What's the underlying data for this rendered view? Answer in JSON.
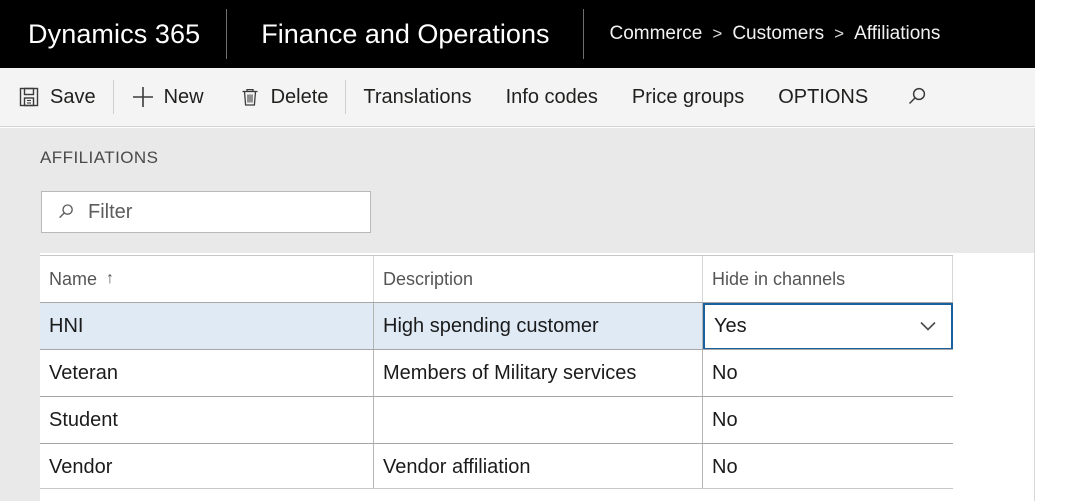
{
  "topbar": {
    "brand": "Dynamics 365",
    "module": "Finance and Operations",
    "breadcrumb": {
      "items": [
        "Commerce",
        "Customers",
        "Affiliations"
      ],
      "separator": ">"
    }
  },
  "command_bar": {
    "items": [
      {
        "label": "Save",
        "icon": "save-icon"
      },
      {
        "label": "New",
        "icon": "plus-icon"
      },
      {
        "label": "Delete",
        "icon": "trash-icon"
      },
      {
        "label": "Translations",
        "icon": ""
      },
      {
        "label": "Info codes",
        "icon": ""
      },
      {
        "label": "Price groups",
        "icon": ""
      },
      {
        "label": "OPTIONS",
        "icon": ""
      }
    ],
    "search_icon": "search-icon"
  },
  "page": {
    "section_title": "AFFILIATIONS",
    "filter": {
      "icon": "search-icon",
      "value": "",
      "placeholder": "Filter"
    },
    "grid": {
      "columns": [
        {
          "label": "Name",
          "sort": "↑"
        },
        {
          "label": "Description",
          "sort": ""
        },
        {
          "label": "Hide in channels",
          "sort": ""
        }
      ],
      "rows": [
        {
          "name": "HNI",
          "description": "High spending customer",
          "hide_in_channels": "Yes",
          "selected": true,
          "editing": true
        },
        {
          "name": "Veteran",
          "description": "Members of Military services",
          "hide_in_channels": "No",
          "selected": false,
          "editing": false
        },
        {
          "name": "Student",
          "description": "",
          "hide_in_channels": "No",
          "selected": false,
          "editing": false
        },
        {
          "name": "Vendor",
          "description": "Vendor affiliation",
          "hide_in_channels": "No",
          "selected": false,
          "editing": false
        }
      ]
    }
  },
  "colors": {
    "topbar_bg": "#000000",
    "cmdbar_bg": "#f4f4f4",
    "panel_bg": "#e9e9e9",
    "selected_row": "#dfeaf5",
    "focus_border": "#19609e"
  }
}
